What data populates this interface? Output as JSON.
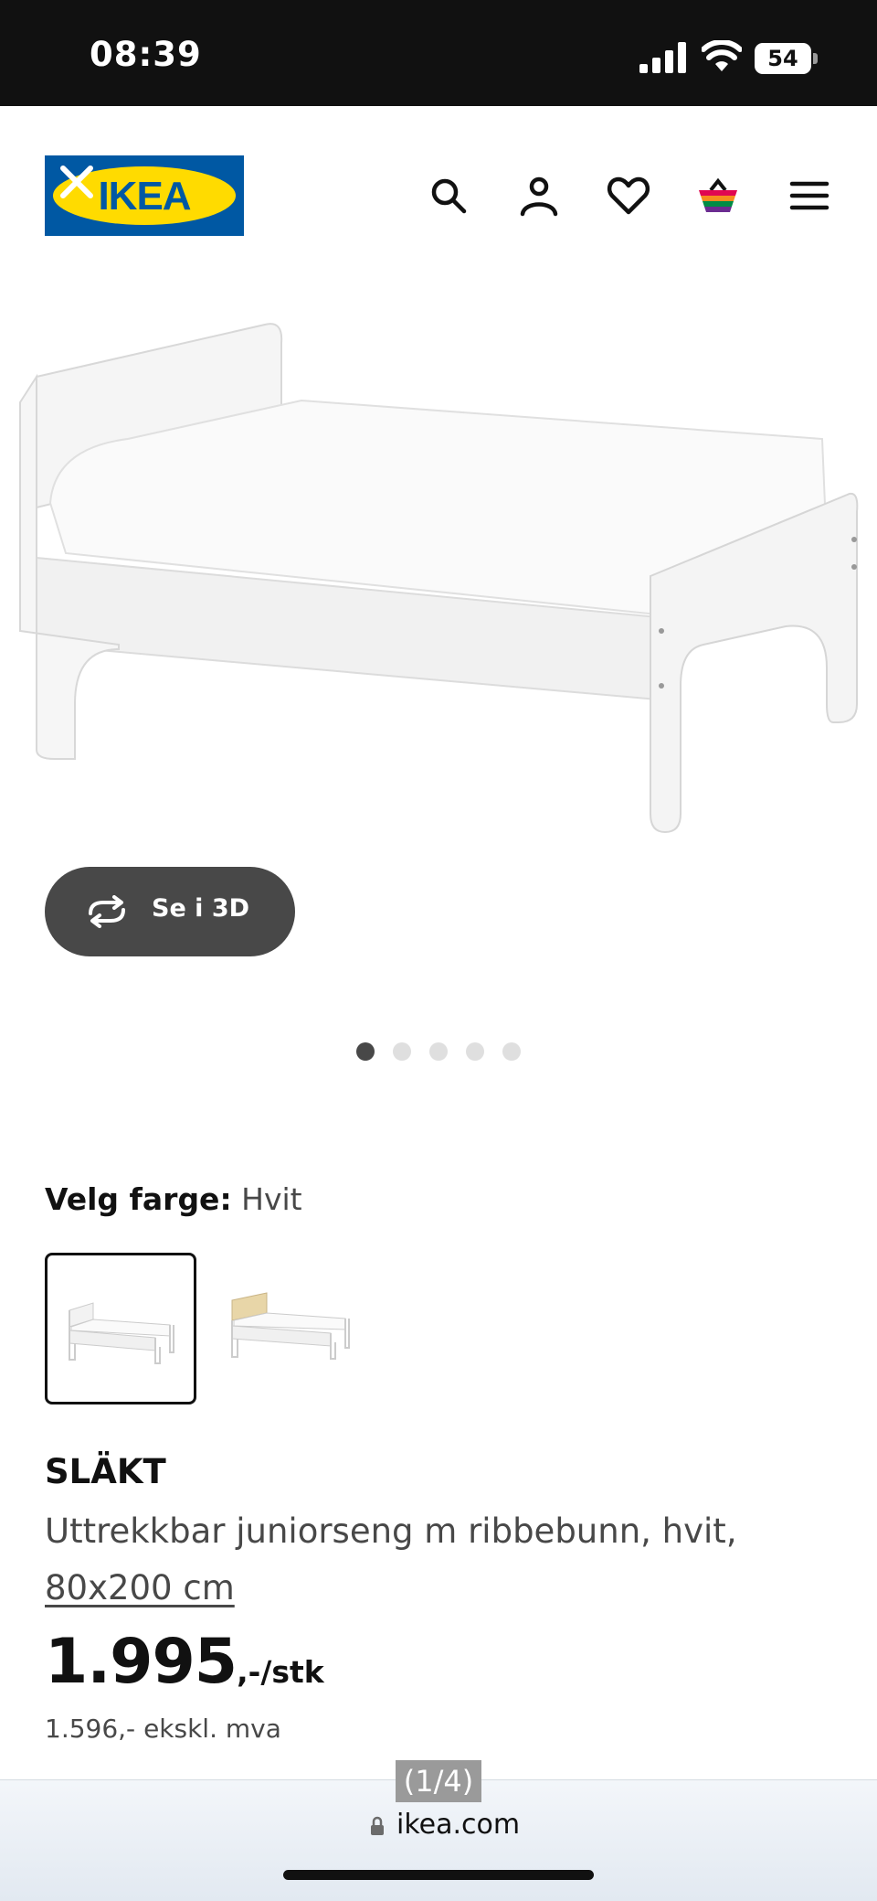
{
  "status_bar": {
    "time": "08:39",
    "battery": "54"
  },
  "header": {
    "logo_text": "IKEA",
    "icons": [
      "search-icon",
      "profile-icon",
      "heart-icon",
      "basket-icon",
      "menu-icon"
    ]
  },
  "gallery": {
    "view_3d_label": "Se i 3D",
    "total_images": 5,
    "active_index": 0
  },
  "color_selector": {
    "label": "Velg farge:",
    "value": "Hvit",
    "options": [
      "white",
      "white-birch"
    ]
  },
  "product": {
    "name": "SLÄKT",
    "description": "Uttrekkbar juniorseng m ribbebunn, hvit,",
    "size": "80x200 cm",
    "price": "1.995",
    "price_suffix": ",-/stk",
    "price_ex_vat": "1.596,- ekskl. mva"
  },
  "browser": {
    "image_counter": "(1/4)",
    "url": "ikea.com"
  },
  "colors": {
    "ikea_blue": "#0058a3",
    "ikea_yellow": "#ffdb00",
    "dark_button": "#484848"
  }
}
